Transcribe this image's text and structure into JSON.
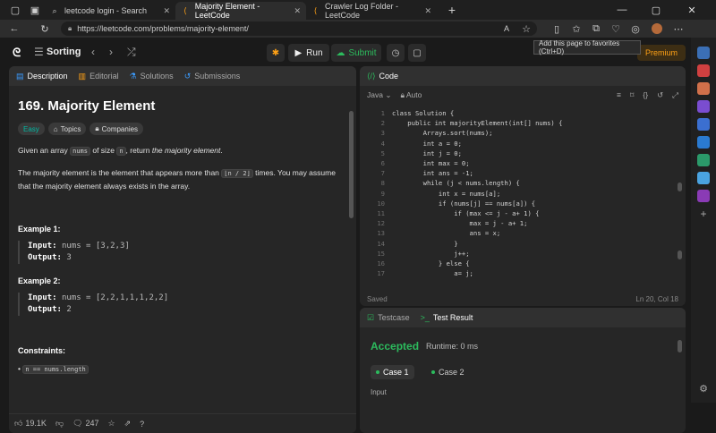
{
  "browser": {
    "tabs": [
      {
        "label": "leetcode login - Search",
        "active": false
      },
      {
        "label": "Majority Element - LeetCode",
        "active": true
      },
      {
        "label": "Crawler Log Folder - LeetCode",
        "active": false
      }
    ],
    "new_tab": "+",
    "url": "https://leetcode.com/problems/majority-element/",
    "tooltip": "Add this page to favorites (Ctrl+D)"
  },
  "toolbar": {
    "list_label": "Sorting",
    "run_label": "Run",
    "submit_label": "Submit",
    "premium_label": "Premium"
  },
  "desc": {
    "tabs": [
      "Description",
      "Editorial",
      "Solutions",
      "Submissions"
    ],
    "title": "169. Majority Element",
    "chips": [
      "Easy",
      "Topics",
      "Companies"
    ],
    "p1_pre": "Given an array",
    "p1_code1": "nums",
    "p1_mid": "of size",
    "p1_code2": "n",
    "p1_post": ", return",
    "p1_em": "the majority element",
    "p1_end": ".",
    "p2_pre": "The majority element is the element that appears more than",
    "p2_code": "⌊n / 2⌋",
    "p2_post": "times. You may assume that the majority element always exists in the array.",
    "ex1_title": "Example 1:",
    "ex1_input_label": "Input:",
    "ex1_input": "nums = [3,2,3]",
    "ex1_output_label": "Output:",
    "ex1_output": "3",
    "ex2_title": "Example 2:",
    "ex2_input_label": "Input:",
    "ex2_input": "nums = [2,2,1,1,1,2,2]",
    "ex2_output_label": "Output:",
    "ex2_output": "2",
    "constraints_title": "Constraints:",
    "constraint1": "n == nums.length",
    "likes": "19.1K",
    "comments": "247"
  },
  "code": {
    "title": "Code",
    "lang": "Java",
    "mode": "Auto",
    "status_left": "Saved",
    "status_right": "Ln 20, Col 18",
    "lines": [
      "class Solution {",
      "    public int majorityElement(int[] nums) {",
      "        Arrays.sort(nums);",
      "        int a = 0;",
      "        int j = 0;",
      "        int max = 0;",
      "        int ans = -1;",
      "        while (j < nums.length) {",
      "            int x = nums[a];",
      "            if (nums[j] == nums[a]) {",
      "                if (max <= j - a+ 1) {",
      "                    max = j - a+ 1;",
      "                    ans = x;",
      "                }",
      "                j++;",
      "            } else {",
      "                a= j;"
    ]
  },
  "test": {
    "tab1": "Testcase",
    "tab2": "Test Result",
    "result": "Accepted",
    "runtime": "Runtime: 0 ms",
    "case1": "Case 1",
    "case2": "Case 2",
    "input_label": "Input"
  },
  "colors": {
    "accent_green": "#2cbb5d",
    "premium": "#ffa116",
    "easy": "#00b8a3"
  }
}
